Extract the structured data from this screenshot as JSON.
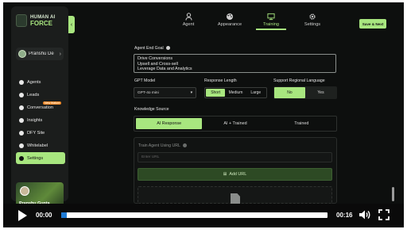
{
  "brand": {
    "line1": "HUMAN AI",
    "line2": "FORCE"
  },
  "user": {
    "name": "Pranshu De"
  },
  "nav": {
    "items": [
      {
        "label": "Agents",
        "icon": "agents-icon"
      },
      {
        "label": "Leads",
        "icon": "leads-icon"
      },
      {
        "label": "Conversation",
        "icon": "conversation-icon",
        "badge": "New feature"
      },
      {
        "label": "Insights",
        "icon": "insights-icon"
      },
      {
        "label": "DFY Site",
        "icon": "site-icon"
      },
      {
        "label": "Whitelabel",
        "icon": "whitelabel-icon"
      },
      {
        "label": "Settings",
        "icon": "settings-icon",
        "active": true
      }
    ]
  },
  "promo": {
    "name": "Pranshu Gupta"
  },
  "tabs": [
    {
      "label": "Agent",
      "icon": "agent-icon"
    },
    {
      "label": "Appearance",
      "icon": "palette-icon"
    },
    {
      "label": "Training",
      "icon": "training-icon",
      "active": true
    },
    {
      "label": "Settings",
      "icon": "gear-icon"
    }
  ],
  "save_button": "Save & Next",
  "form": {
    "goal_label": "Agent End Goal",
    "goals": [
      "Drive Conversions",
      "Upsell and Cross-sell",
      "Leverage Data and Analytics"
    ],
    "gpt_label": "GPT Model",
    "gpt_value": "GPT-4o mini",
    "resp_label": "Response Length",
    "resp_options": [
      "Short",
      "Medium",
      "Large"
    ],
    "resp_selected": "Short",
    "regional_label": "Support Regional Language",
    "regional_options": [
      "No",
      "Yes"
    ],
    "regional_selected": "No",
    "knowledge_label": "Knowledge Source",
    "knowledge_options": [
      "AI Response",
      "AI + Trained",
      "Trained"
    ],
    "knowledge_selected": "AI Response",
    "train_label": "Train Agent Using URL",
    "url_placeholder": "Enter URL",
    "add_url": "Add URL"
  },
  "player": {
    "current": "00:00",
    "duration": "00:16",
    "progress": 0.0
  },
  "colors": {
    "accent": "#a8e67f",
    "progress": "#1e7bd6",
    "bg": "#0d0f0e"
  }
}
